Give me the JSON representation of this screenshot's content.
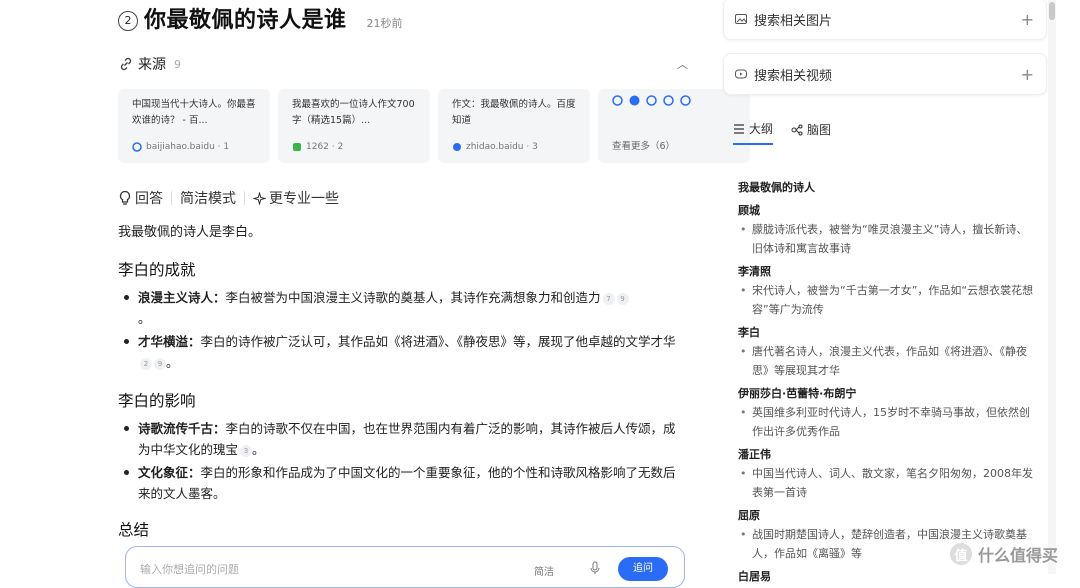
{
  "question": {
    "number": "2",
    "title": "你最敬佩的诗人是谁",
    "time": "21秒前"
  },
  "sources": {
    "label": "来源",
    "count": "9",
    "cards": [
      {
        "text": "中国现当代十大诗人。你最喜欢谁的诗？ - 百...",
        "site": "baijiahao.baidu · 1"
      },
      {
        "text": "我最喜欢的一位诗人作文700字（精选15篇）...",
        "site": "1262 · 2"
      },
      {
        "text": "作文：我最敬佩的诗人。百度知道",
        "site": "zhidao.baidu · 3"
      }
    ],
    "more": "查看更多（6）"
  },
  "modes": {
    "answer": "回答",
    "concise": "简洁模式",
    "pro": "更专业一些"
  },
  "answer": {
    "intro": "我最敬佩的诗人是李白。",
    "sections": [
      {
        "heading": "李白的成就",
        "items": [
          {
            "bold": "浪漫主义诗人：",
            "text": "李白被誉为中国浪漫主义诗歌的奠基人，其诗作充满想象力和创造力",
            "cites": [
              "7",
              "9"
            ],
            "tail": "。"
          },
          {
            "bold": "才华横溢：",
            "text": "李白的诗作被广泛认可，其作品如《将进酒》、《静夜思》等，展现了他卓越的文学才华",
            "cites": [
              "2",
              "9"
            ],
            "tail": "。"
          }
        ]
      },
      {
        "heading": "李白的影响",
        "items": [
          {
            "bold": "诗歌流传千古：",
            "text": "李白的诗歌不仅在中国，也在世界范围内有着广泛的影响，其诗作被后人传颂，成为中华文化的瑰宝",
            "cites": [
              "3"
            ],
            "tail": "。"
          },
          {
            "bold": "文化象征：",
            "text": "李白的形象和作品成为了中国文化的一个重要象征，他的个性和诗歌风格影响了无数后来的文人墨客。",
            "cites": [],
            "tail": ""
          }
        ]
      }
    ],
    "summary_heading": "总结"
  },
  "input": {
    "placeholder": "输入你想追问的问题",
    "mode": "简洁",
    "send": "追问"
  },
  "right": {
    "search_images": "搜索相关图片",
    "search_videos": "搜索相关视频",
    "tab_outline": "大纲",
    "tab_mindmap": "脑图",
    "outline_root": "我最敬佩的诗人",
    "poets": [
      {
        "name": "顾城",
        "desc": "朦胧诗派代表，被誉为“唯灵浪漫主义”诗人，擅长新诗、旧体诗和寓言故事诗"
      },
      {
        "name": "李清照",
        "desc": "宋代诗人，被誉为“千古第一才女”，作品如“云想衣裳花想容”等广为流传"
      },
      {
        "name": "李白",
        "desc": "唐代著名诗人，浪漫主义代表，作品如《将进酒》、《静夜思》等展现其才华"
      },
      {
        "name": "伊丽莎白·芭蕾特·布朗宁",
        "desc": "英国维多利亚时代诗人，15岁时不幸骑马事故，但依然创作出许多优秀作品"
      },
      {
        "name": "潘正伟",
        "desc": "中国当代诗人、词人、散文家，笔名夕阳匆匆，2008年发表第一首诗"
      },
      {
        "name": "屈原",
        "desc": "战国时期楚国诗人，楚辞创造者，中国浪漫主义诗歌奠基人，作品如《离骚》等"
      },
      {
        "name": "白居易",
        "desc": ""
      }
    ]
  },
  "watermark": {
    "badge": "值",
    "text": "什么值得买"
  }
}
